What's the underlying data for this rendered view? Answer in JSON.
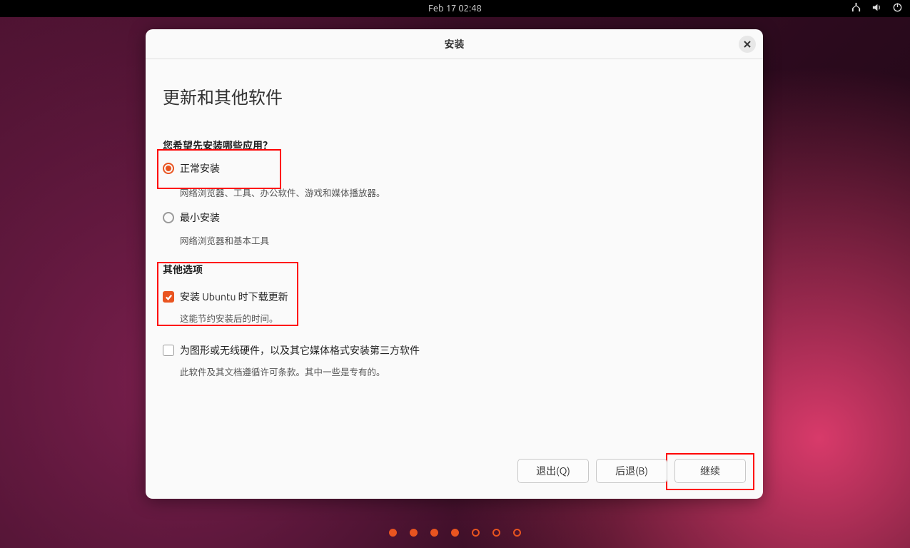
{
  "topbar": {
    "datetime": "Feb 17  02:48"
  },
  "window": {
    "title": "安装"
  },
  "page": {
    "heading": "更新和其他软件",
    "section1": {
      "label": "您希望先安装哪些应用？",
      "opt_normal": "正常安装",
      "opt_normal_help": "网络浏览器、工具、办公软件、游戏和媒体播放器。",
      "opt_minimal": "最小安装",
      "opt_minimal_help": "网络浏览器和基本工具"
    },
    "section2": {
      "label": "其他选项",
      "chk_download": "安装 Ubuntu 时下载更新",
      "chk_download_help": "这能节约安装后的时间。",
      "chk_thirdparty": "为图形或无线硬件，以及其它媒体格式安装第三方软件",
      "chk_thirdparty_help": "此软件及其文档遵循许可条款。其中一些是专有的。"
    },
    "buttons": {
      "quit": "退出(Q)",
      "back": "后退(B)",
      "continue": "继续"
    }
  },
  "progress": {
    "total": 7,
    "current": 4
  }
}
